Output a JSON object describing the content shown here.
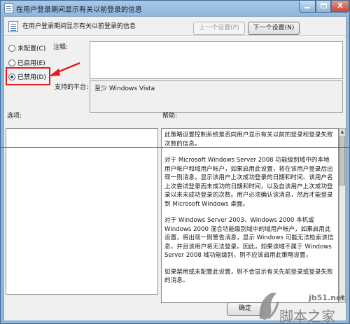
{
  "window": {
    "title": "在用户登录期间显示有关以前登录的信息",
    "controls": {
      "minimize": "—",
      "maximize": "□",
      "close": "X"
    }
  },
  "header": {
    "title": "在用户登录期间显示有关以前登录的信息",
    "prev_button": "上一个设置(P)",
    "next_button": "下一个设置(N)"
  },
  "settings": {
    "options": [
      {
        "label": "未配置(C)",
        "checked": false
      },
      {
        "label": "已启用(E)",
        "checked": false
      },
      {
        "label": "已禁用(D)",
        "checked": true
      }
    ],
    "comment_label": "注释:",
    "comment_value": "",
    "platform_label": "支持的平台:",
    "platform_value": "至少 Windows Vista"
  },
  "sections": {
    "options_label": "选项:",
    "help_label": "帮助:"
  },
  "help": {
    "paragraphs": [
      "此策略设置控制系统是否向用户显示有关以前的登录和登录失败次数的信息。",
      "对于 Microsoft Windows Server 2008 功能级别域中的本地用户帐户和域用户帐户，如果启用此设置，将在该用户登录后出现一则消息，显示该用户上次成功登录的日期和时间、该用户名上次尝试登录而未成功的日期和时间，以及自该用户上次成功登录以来未成功登录的次数。用户必须确认该消息，然后才能登录到 Microsoft Windows 桌面。",
      "对于 Windows Server 2003、Windows 2000 本机或 Windows 2000 混合功能级别域中的域用户帐户，如果启用此设置，将出现一则警告消息，显示 Windows 可能无法检索该信息，并且该用户将无法登录。因此，如果该域不属于 Windows Server 2008 域功能级别，则不应该启用此策略设置。",
      "如果禁用或未配置此设置，则不会显示有关先前登录或登录失败的消息。"
    ]
  },
  "footer": {
    "ok_button": "确定"
  },
  "watermark": {
    "site": "jb51.net",
    "name": "脚本之家"
  },
  "colors": {
    "highlight": "#e01f1f",
    "titlebar": "#8fb6dc"
  }
}
